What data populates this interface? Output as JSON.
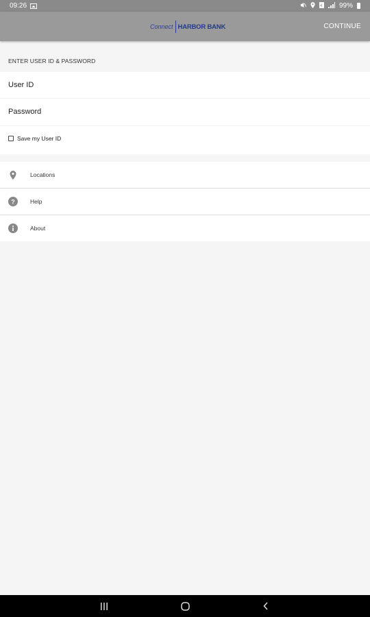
{
  "status_bar": {
    "time": "09:26",
    "battery": "99%",
    "icons": [
      "image-icon",
      "mute-icon",
      "location-icon",
      "data-icon",
      "signal-icon",
      "battery-icon"
    ]
  },
  "header": {
    "logo_connect": "Connect",
    "logo_bank": "HARBOR BANK",
    "continue_label": "CONTINUE"
  },
  "login": {
    "section_label": "ENTER USER ID & PASSWORD",
    "user_id_placeholder": "User ID",
    "password_placeholder": "Password",
    "save_user_id_label": "Save my User ID",
    "save_user_id_checked": false
  },
  "menu": {
    "items": [
      {
        "label": "Locations",
        "icon": "location-pin-icon"
      },
      {
        "label": "Help",
        "icon": "help-icon"
      },
      {
        "label": "About",
        "icon": "info-icon"
      }
    ]
  },
  "colors": {
    "header_bg": "#9a9a9a",
    "status_bg": "#8a8a8a",
    "brand_blue": "#243a8c",
    "page_bg": "#f5f5f5"
  }
}
